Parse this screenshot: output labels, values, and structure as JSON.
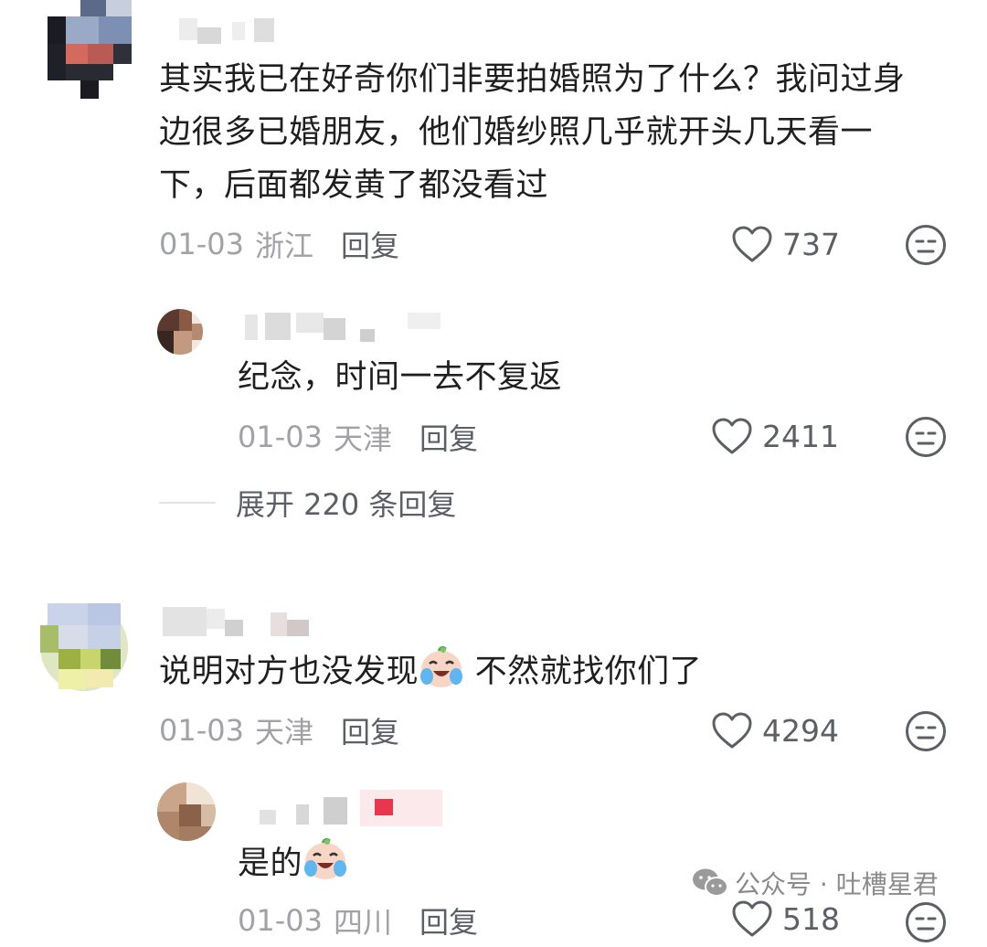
{
  "comments": [
    {
      "text": "其实我已在好奇你们非要拍婚照为了什么？我问过身边很多已婚朋友，他们婚纱照几乎就开头几天看一下，后面都发黄了都没看过",
      "lines": [
        "其实我已在好奇你们非要拍婚照为了什么？我问过身",
        "边很多已婚朋友，他们婚纱照几乎就开头几天看一",
        "下，后面都发黄了都没看过"
      ],
      "date": "01-03",
      "location": "浙江",
      "reply_label": "回复",
      "likes": "737",
      "replies": [
        {
          "text": "纪念，时间一去不复返",
          "date": "01-03",
          "location": "天津",
          "reply_label": "回复",
          "likes": "2411"
        }
      ],
      "expand_label": "展开 220 条回复"
    },
    {
      "text_before_emoji": "说明对方也没发现",
      "text_after_emoji": " 不然就找你们了",
      "emoji": "crying-laughing-emoji",
      "date": "01-03",
      "location": "天津",
      "reply_label": "回复",
      "likes": "4294",
      "replies": [
        {
          "text": "是的",
          "emoji": "crying-laughing-emoji",
          "date": "01-03",
          "location": "四川",
          "reply_label": "回复",
          "likes": "518"
        }
      ]
    }
  ],
  "watermark": {
    "text": "公众号 · 吐槽星君",
    "icon": "wechat-icon"
  },
  "colors": {
    "text_primary": "#1f1f1f",
    "meta_gray": "#a1a2a7",
    "action_gray": "#5d5f66"
  }
}
